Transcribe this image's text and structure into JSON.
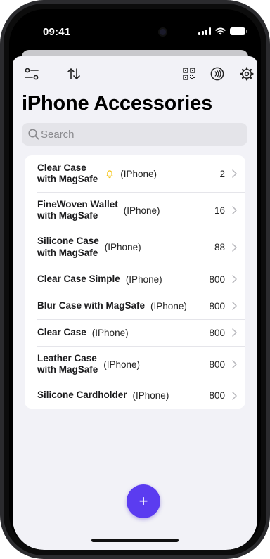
{
  "status_bar": {
    "time": "09:41"
  },
  "page": {
    "title": "iPhone Accessories"
  },
  "search": {
    "placeholder": "Search",
    "value": ""
  },
  "toolbar": {
    "left_icons": [
      "filter-icon",
      "sort-icon"
    ],
    "right_icons": [
      "qr-code-icon",
      "nfc-icon",
      "gear-icon"
    ]
  },
  "items": [
    {
      "name_line1": "Clear Case",
      "name_line2": "with MagSafe",
      "device": "(IPhone)",
      "count": "2",
      "bell": true
    },
    {
      "name_line1": "FineWoven Wallet",
      "name_line2": "with MagSafe",
      "device": "(IPhone)",
      "count": "16",
      "bell": false
    },
    {
      "name_line1": "Silicone Case",
      "name_line2": "with MagSafe",
      "device": "(IPhone)",
      "count": "88",
      "bell": false
    },
    {
      "name_line1": "Clear Case Simple",
      "name_line2": "",
      "device": "(IPhone)",
      "count": "800",
      "bell": false
    },
    {
      "name_line1": "Blur Case with MagSafe",
      "name_line2": "",
      "device": "(IPhone)",
      "count": "800",
      "bell": false
    },
    {
      "name_line1": "Clear Case",
      "name_line2": "",
      "device": "(IPhone)",
      "count": "800",
      "bell": false
    },
    {
      "name_line1": "Leather Case",
      "name_line2": "with MagSafe",
      "device": "(IPhone)",
      "count": "800",
      "bell": false
    },
    {
      "name_line1": "Silicone Cardholder",
      "name_line2": "",
      "device": "(IPhone)",
      "count": "800",
      "bell": false
    }
  ],
  "fab": {
    "label": "+"
  },
  "colors": {
    "accent": "#5b3cf0",
    "bell": "#f5c518",
    "background": "#f2f2f7"
  }
}
